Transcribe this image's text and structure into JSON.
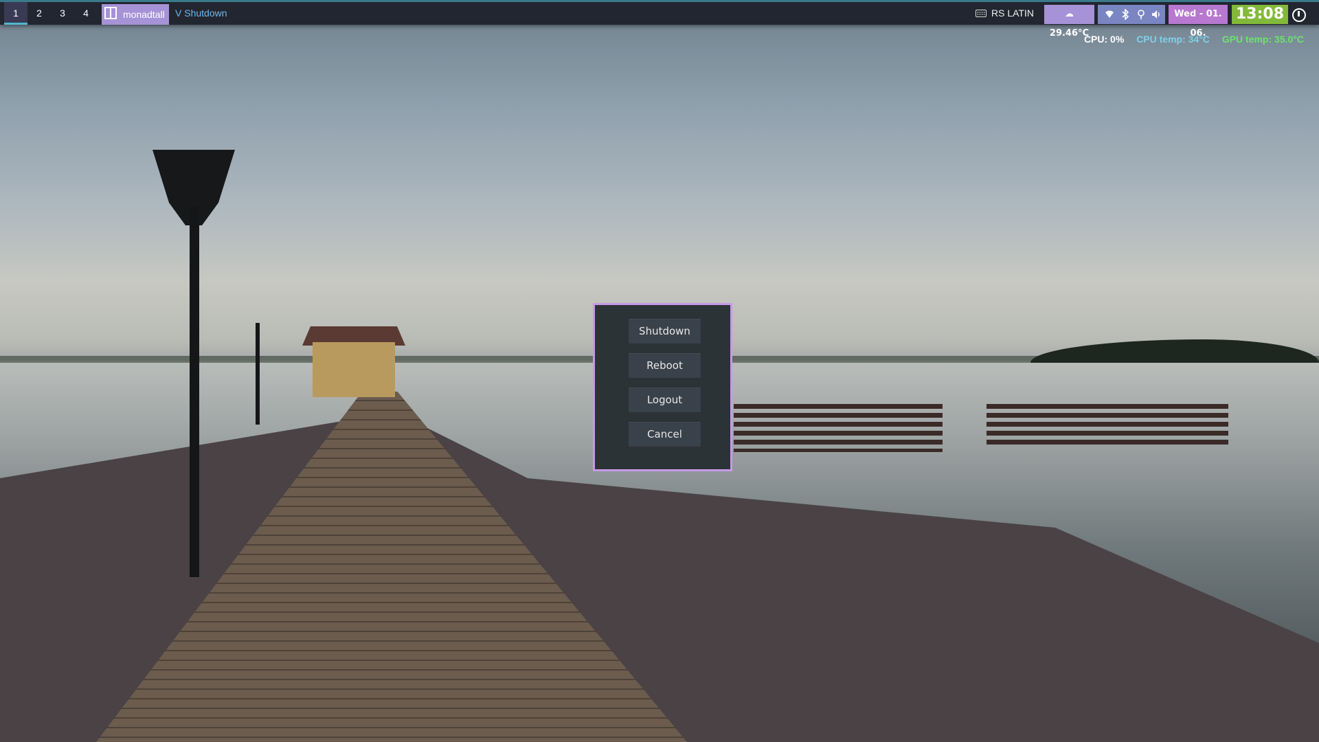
{
  "workspaces": [
    {
      "label": "1",
      "active": true
    },
    {
      "label": "2",
      "active": false
    },
    {
      "label": "3",
      "active": false
    },
    {
      "label": "4",
      "active": false
    }
  ],
  "layout": {
    "label": "monadtall",
    "icon": "layout-monadtall-icon"
  },
  "window_title": "V Shutdown",
  "keyboard": {
    "label": "RS LATIN",
    "icon": "keyboard-icon"
  },
  "weather": {
    "label": "☁ 29.46°C",
    "icon": "cloud-icon"
  },
  "status_icons": [
    "wifi-icon",
    "bluetooth-icon",
    "location-icon",
    "volume-icon"
  ],
  "date": "Wed - 01. 06.",
  "clock": "13:08",
  "stats": {
    "cpu": "CPU: 0%",
    "cpu_temp": "CPU temp: 34°C",
    "gpu_temp": "GPU temp: 35.0°C"
  },
  "dialog": {
    "buttons": [
      "Shutdown",
      "Reboot",
      "Logout",
      "Cancel"
    ]
  },
  "colors": {
    "bar_bg": "#222630",
    "accent_purple": "#a692d6",
    "date_magenta": "#b778cf",
    "clock_green": "#83b93a",
    "dialog_border": "#c59ae6"
  }
}
